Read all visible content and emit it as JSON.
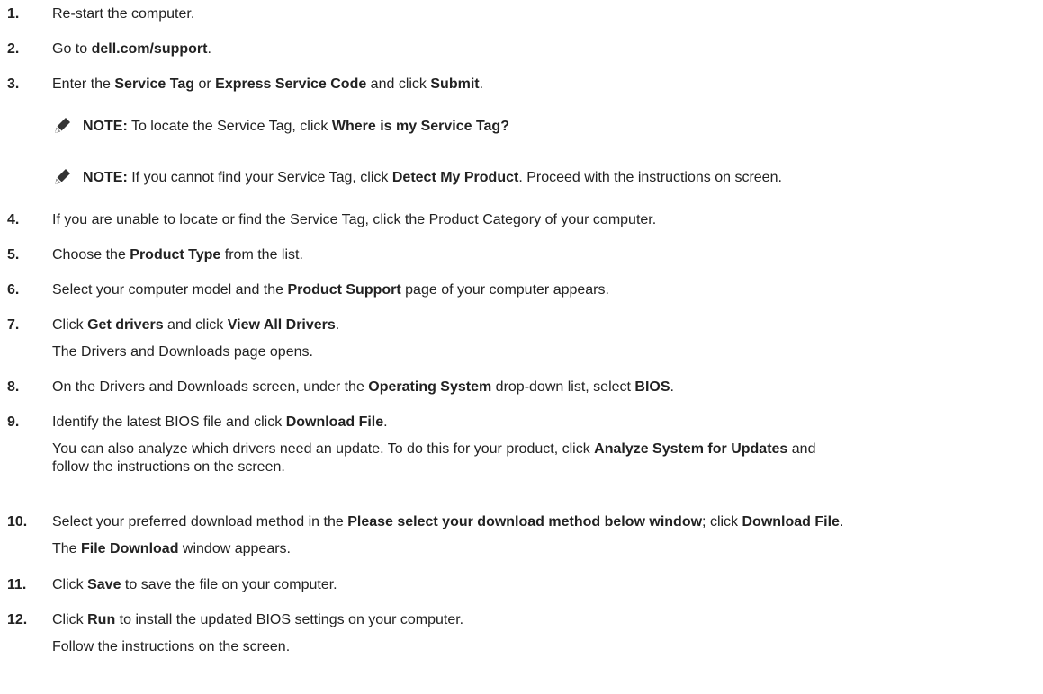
{
  "steps": [
    {
      "num": "1.",
      "lines": [
        [
          {
            "t": "Re-start the computer.",
            "b": false
          }
        ]
      ]
    },
    {
      "num": "2.",
      "lines": [
        [
          {
            "t": "Go to ",
            "b": false
          },
          {
            "t": "dell.com/support",
            "b": true
          },
          {
            "t": ".",
            "b": false
          }
        ]
      ]
    },
    {
      "num": "3.",
      "lines": [
        [
          {
            "t": "Enter the ",
            "b": false
          },
          {
            "t": "Service Tag",
            "b": true
          },
          {
            "t": " or ",
            "b": false
          },
          {
            "t": "Express Service Code",
            "b": true
          },
          {
            "t": " and click ",
            "b": false
          },
          {
            "t": "Submit",
            "b": true
          },
          {
            "t": ".",
            "b": false
          }
        ]
      ]
    },
    {
      "num": "4.",
      "lines": [
        [
          {
            "t": "If you are unable to locate or find the Service Tag, click the Product Category of your computer.",
            "b": false
          }
        ]
      ]
    },
    {
      "num": "5.",
      "lines": [
        [
          {
            "t": "Choose the ",
            "b": false
          },
          {
            "t": "Product Type",
            "b": true
          },
          {
            "t": " from the list.",
            "b": false
          }
        ]
      ]
    },
    {
      "num": "6.",
      "lines": [
        [
          {
            "t": "Select your computer model and the ",
            "b": false
          },
          {
            "t": "Product Support",
            "b": true
          },
          {
            "t": " page of your computer appears.",
            "b": false
          }
        ]
      ]
    },
    {
      "num": "7.",
      "lines": [
        [
          {
            "t": "Click ",
            "b": false
          },
          {
            "t": "Get drivers",
            "b": true
          },
          {
            "t": " and click ",
            "b": false
          },
          {
            "t": "View All Drivers",
            "b": true
          },
          {
            "t": ".",
            "b": false
          }
        ],
        [
          {
            "t": "The Drivers and Downloads page opens.",
            "b": false
          }
        ]
      ]
    },
    {
      "num": "8.",
      "lines": [
        [
          {
            "t": "On the Drivers and Downloads screen, under the ",
            "b": false
          },
          {
            "t": "Operating System",
            "b": true
          },
          {
            "t": " drop-down list, select ",
            "b": false
          },
          {
            "t": "BIOS",
            "b": true
          },
          {
            "t": ".",
            "b": false
          }
        ]
      ]
    },
    {
      "num": "9.",
      "lines": [
        [
          {
            "t": "Identify the latest BIOS file and click ",
            "b": false
          },
          {
            "t": "Download File",
            "b": true
          },
          {
            "t": ".",
            "b": false
          }
        ],
        [
          {
            "t": "You can also analyze which drivers need an update. To do this for your product, click ",
            "b": false
          },
          {
            "t": "Analyze System for Updates",
            "b": true
          },
          {
            "t": " and",
            "b": false
          }
        ],
        [
          {
            "t": "follow the instructions on the screen.",
            "b": false
          }
        ]
      ]
    },
    {
      "num": "10.",
      "lines": [
        [
          {
            "t": "Select your preferred download method in the ",
            "b": false
          },
          {
            "t": "Please select your download method below window",
            "b": true
          },
          {
            "t": "; click ",
            "b": false
          },
          {
            "t": "Download File",
            "b": true
          },
          {
            "t": ".",
            "b": false
          }
        ],
        [
          {
            "t": "The ",
            "b": false
          },
          {
            "t": "File Download",
            "b": true
          },
          {
            "t": " window appears.",
            "b": false
          }
        ]
      ]
    },
    {
      "num": "11.",
      "lines": [
        [
          {
            "t": "Click ",
            "b": false
          },
          {
            "t": "Save",
            "b": true
          },
          {
            "t": " to save the file on your computer.",
            "b": false
          }
        ]
      ]
    },
    {
      "num": "12.",
      "lines": [
        [
          {
            "t": "Click ",
            "b": false
          },
          {
            "t": "Run",
            "b": true
          },
          {
            "t": " to install the updated BIOS settings on your computer.",
            "b": false
          }
        ],
        [
          {
            "t": "Follow the instructions on the screen.",
            "b": false
          }
        ]
      ]
    }
  ],
  "notes": [
    {
      "icon": "pencil-note-icon",
      "label": "NOTE:",
      "segments": [
        {
          "t": " To locate the Service Tag, click ",
          "b": false
        },
        {
          "t": "Where is my Service Tag?",
          "b": true
        }
      ]
    },
    {
      "icon": "pencil-note-icon",
      "label": "NOTE:",
      "segments": [
        {
          "t": " If you cannot find your Service Tag, click ",
          "b": false
        },
        {
          "t": "Detect My Product",
          "b": true
        },
        {
          "t": ". Proceed with the instructions on screen.",
          "b": false
        }
      ]
    }
  ]
}
